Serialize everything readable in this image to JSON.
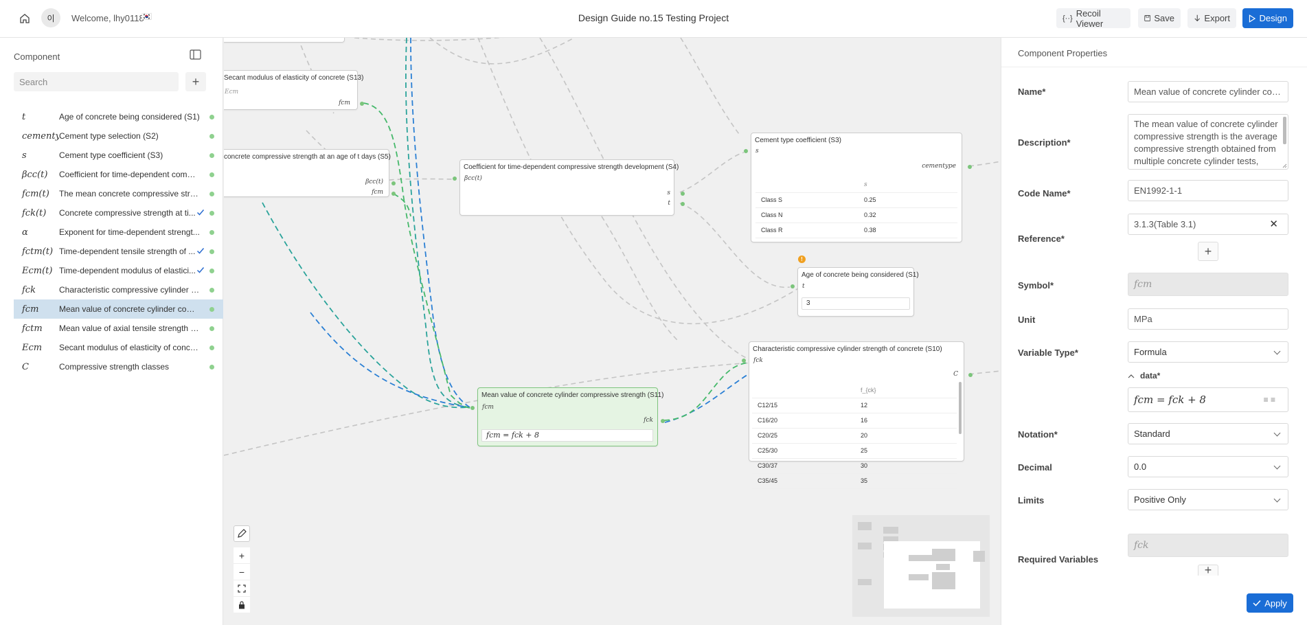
{
  "header": {
    "avatar_initials": "이",
    "welcome": "Welcome, lhy0118",
    "flag": "🇰🇷",
    "project_title": "Design Guide no.15 Testing Project",
    "recoil_label": "Recoil Viewer",
    "save_label": "Save",
    "export_label": "Export",
    "design_label": "Design"
  },
  "sidebar": {
    "title": "Component",
    "search_placeholder": "Search",
    "items": [
      {
        "symbol": "t",
        "label": "Age of concrete being considered (S1)",
        "check": false
      },
      {
        "symbol": "cementype",
        "label": "Cement type selection (S2)",
        "check": false
      },
      {
        "symbol": "s",
        "label": "Cement type coefficient (S3)",
        "check": false
      },
      {
        "symbol": "βcc(t)",
        "label": "Coefficient for time-dependent compr...",
        "check": false
      },
      {
        "symbol": "fcm(t)",
        "label": "The mean concrete compressive stren...",
        "check": false
      },
      {
        "symbol": "fck(t)",
        "label": "Concrete compressive strength at ti...",
        "check": true
      },
      {
        "symbol": "α",
        "label": "Exponent for time-dependent strengt...",
        "check": false
      },
      {
        "symbol": "fctm(t)",
        "label": "Time-dependent tensile strength of ...",
        "check": true
      },
      {
        "symbol": "Ecm(t)",
        "label": "Time-dependent modulus of elastici...",
        "check": true
      },
      {
        "symbol": "fck",
        "label": "Characteristic compressive cylinder st...",
        "check": false
      },
      {
        "symbol": "fcm",
        "label": "Mean value of concrete cylinder comp...",
        "check": false,
        "selected": true
      },
      {
        "symbol": "fctm",
        "label": "Mean value of axial tensile strength of ...",
        "check": false
      },
      {
        "symbol": "Ecm",
        "label": "Secant modulus of elasticity of concre...",
        "check": false
      },
      {
        "symbol": "C",
        "label": "Compressive strength classes",
        "check": false
      }
    ]
  },
  "canvas": {
    "nodes": {
      "s13": {
        "title": "Secant modulus of elasticity of concrete (S13)",
        "in": "Ecm",
        "out": "fcm"
      },
      "s5": {
        "title": "concrete compressive strength at an age of t days (S5)",
        "out1": "βcc(t)",
        "out2": "fcm"
      },
      "s4": {
        "title": "Coefficient for time-dependent compressive strength development (S4)",
        "in": "βcc(t)",
        "out1": "s",
        "out2": "t"
      },
      "s3": {
        "title": "Cement type coefficient (S3)",
        "in": "s",
        "out": "cementype",
        "col": "s",
        "rows": [
          {
            "k": "Class S",
            "v": "0.25"
          },
          {
            "k": "Class N",
            "v": "0.32"
          },
          {
            "k": "Class R",
            "v": "0.38"
          }
        ]
      },
      "s1": {
        "title": "Age of concrete being considered (S1)",
        "in": "t",
        "value": "3",
        "warning": "!"
      },
      "s10": {
        "title": "Characteristic compressive cylinder strength of concrete (S10)",
        "in": "fck",
        "out": "C",
        "col": "f_{ck}",
        "rows": [
          {
            "k": "C12/15",
            "v": "12"
          },
          {
            "k": "C16/20",
            "v": "16"
          },
          {
            "k": "C20/25",
            "v": "20"
          },
          {
            "k": "C25/30",
            "v": "25"
          },
          {
            "k": "C30/37",
            "v": "30"
          },
          {
            "k": "C35/45",
            "v": "35"
          }
        ]
      },
      "s11": {
        "title": "Mean value of concrete cylinder compressive strength (S11)",
        "in": "fcm",
        "out": "fck",
        "formula": "fcm = fck + 8"
      }
    }
  },
  "props": {
    "title": "Component Properties",
    "name_label": "Name*",
    "name_value": "Mean value of concrete cylinder compressive strength",
    "desc_label": "Description*",
    "desc_value": "The mean value of concrete cylinder compressive strength is the average compressive strength obtained from multiple concrete cylinder tests,",
    "code_label": "Code Name*",
    "code_value": "EN1992-1-1",
    "ref_label": "Reference*",
    "ref_value": "3.1.3(Table 3.1)",
    "symbol_label": "Symbol*",
    "symbol_value": "fcm",
    "unit_label": "Unit",
    "unit_value": "MPa",
    "vartype_label": "Variable Type*",
    "vartype_value": "Formula",
    "data_label": "data*",
    "data_formula": "fcm = fck + 8",
    "notation_label": "Notation*",
    "notation_value": "Standard",
    "decimal_label": "Decimal",
    "decimal_value": "0.0",
    "limits_label": "Limits",
    "limits_value": "Positive Only",
    "reqvars_label": "Required Variables",
    "reqvars_value": "fck",
    "apply_label": "Apply"
  },
  "colors": {
    "accent": "#1a6dd6",
    "port": "#7cc57c",
    "edge_green": "#45b86a",
    "edge_blue": "#2a7fd4",
    "edge_teal": "#2aa39a",
    "edge_gray": "#bdbdbd",
    "selected_row": "#cfe0ee",
    "selected_node": "#e5f4e3"
  }
}
